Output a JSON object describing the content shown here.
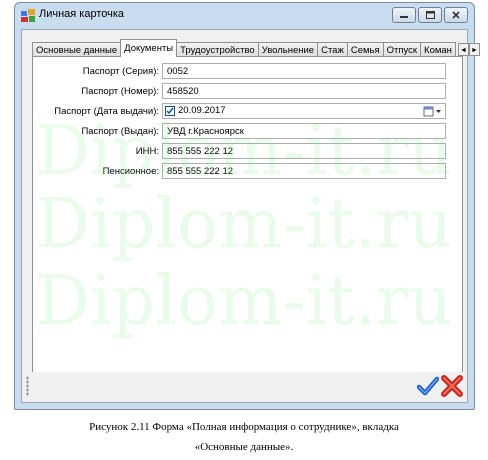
{
  "window": {
    "title": "Личная карточка"
  },
  "tabs": [
    {
      "label": "Основные данные",
      "active": false
    },
    {
      "label": "Документы",
      "active": true
    },
    {
      "label": "Трудоустройство",
      "active": false
    },
    {
      "label": "Увольнение",
      "active": false
    },
    {
      "label": "Стаж",
      "active": false
    },
    {
      "label": "Семья",
      "active": false
    },
    {
      "label": "Отпуск",
      "active": false
    },
    {
      "label": "Коман",
      "active": false
    }
  ],
  "fields": {
    "passport_series": {
      "label": "Паспорт (Серия):",
      "value": "0052"
    },
    "passport_number": {
      "label": "Паспорт (Номер):",
      "value": "458520"
    },
    "passport_date": {
      "label": "Паспорт (Дата выдачи):",
      "value": "20.09.2017",
      "checked": true
    },
    "passport_issued": {
      "label": "Паспорт (Выдан):",
      "value": "УВД г.Красноярск"
    },
    "inn": {
      "label": "ИНН:",
      "value": "855 555 222 12"
    },
    "pension": {
      "label": "Пенсионное:",
      "value": "855 555 222 12"
    }
  },
  "watermark": "Diplom-it.ru",
  "caption": {
    "line1": "Рисунок 2.11  Форма «Полная информация о сотруднике», вкладка",
    "line2": "«Основные данные»."
  },
  "colors": {
    "ok": "#2a6fd6",
    "cancel": "#d0342c"
  }
}
